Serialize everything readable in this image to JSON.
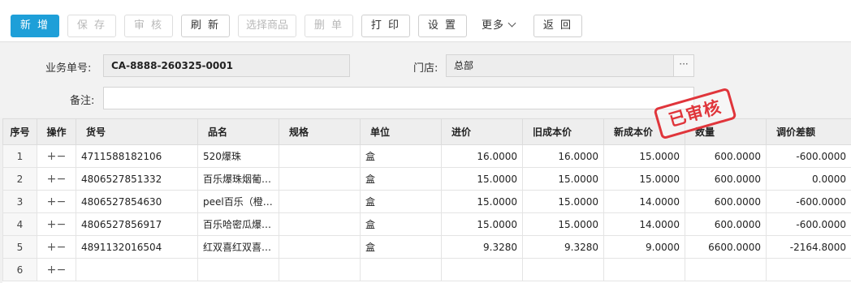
{
  "toolbar": {
    "new_label": "新 增",
    "save_label": "保 存",
    "audit_label": "审 核",
    "refresh_label": "刷 新",
    "select_goods_label": "选择商品",
    "delete_label": "删 单",
    "print_label": "打 印",
    "settings_label": "设 置",
    "more_label": "更多",
    "back_label": "返 回"
  },
  "form": {
    "order_no_label": "业务单号:",
    "order_no_value": "CA-8888-260325-0001",
    "store_label": "门店:",
    "store_value": "总部",
    "store_picker": "···",
    "remark_label": "备注:",
    "remark_value": ""
  },
  "stamp_text": "已审核",
  "table": {
    "headers": {
      "seq": "序号",
      "op": "操作",
      "code": "货号",
      "name": "品名",
      "spec": "规格",
      "unit": "单位",
      "price": "进价",
      "old_cost": "旧成本价",
      "new_cost": "新成本价",
      "qty": "数量",
      "diff": "调价差额"
    },
    "op_add": "+",
    "op_remove": "−",
    "rows": [
      {
        "seq": "1",
        "code": "4711588182106",
        "name": "520爆珠",
        "spec": "",
        "unit": "盒",
        "price": "16.0000",
        "old_cost": "16.0000",
        "new_cost": "15.0000",
        "qty": "600.0000",
        "diff": "-600.0000"
      },
      {
        "seq": "2",
        "code": "4806527851332",
        "name": "百乐爆珠烟葡…",
        "spec": "",
        "unit": "盒",
        "price": "15.0000",
        "old_cost": "15.0000",
        "new_cost": "15.0000",
        "qty": "600.0000",
        "diff": "0.0000"
      },
      {
        "seq": "3",
        "code": "4806527854630",
        "name": "peel百乐（橙…",
        "spec": "",
        "unit": "盒",
        "price": "15.0000",
        "old_cost": "15.0000",
        "new_cost": "14.0000",
        "qty": "600.0000",
        "diff": "-600.0000"
      },
      {
        "seq": "4",
        "code": "4806527856917",
        "name": "百乐哈密瓜爆…",
        "spec": "",
        "unit": "盒",
        "price": "15.0000",
        "old_cost": "15.0000",
        "new_cost": "14.0000",
        "qty": "600.0000",
        "diff": "-600.0000"
      },
      {
        "seq": "5",
        "code": "4891132016504",
        "name": "红双喜红双喜…",
        "spec": "",
        "unit": "盒",
        "price": "9.3280",
        "old_cost": "9.3280",
        "new_cost": "9.0000",
        "qty": "6600.0000",
        "diff": "-2164.8000"
      },
      {
        "seq": "6",
        "code": "",
        "name": "",
        "spec": "",
        "unit": "",
        "price": "",
        "old_cost": "",
        "new_cost": "",
        "qty": "",
        "diff": ""
      }
    ]
  }
}
